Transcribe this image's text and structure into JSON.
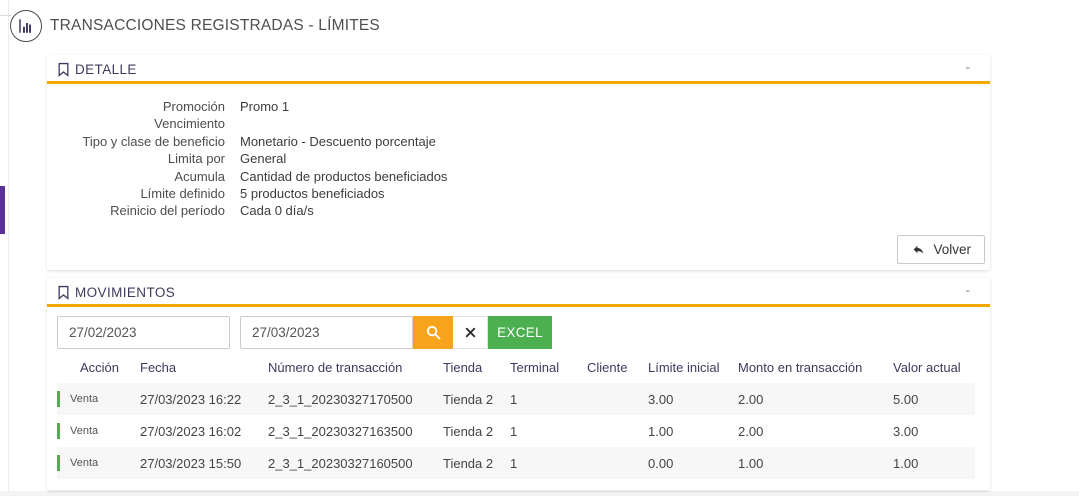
{
  "page": {
    "title": "TRANSACCIONES REGISTRADAS - LÍMITES"
  },
  "detalle": {
    "title": "DETALLE",
    "collapse_label": "-",
    "fields": [
      {
        "label": "Promoción",
        "value": "Promo 1"
      },
      {
        "label": "Vencimiento",
        "value": ""
      },
      {
        "label": "Tipo y clase de beneficio",
        "value": "Monetario - Descuento porcentaje"
      },
      {
        "label": "Limita por",
        "value": "General"
      },
      {
        "label": "Acumula",
        "value": "Cantidad de productos beneficiados"
      },
      {
        "label": "Límite definido",
        "value": "5 productos beneficiados"
      },
      {
        "label": "Reinicio del período",
        "value": "Cada 0 día/s"
      }
    ],
    "back_button_label": "Volver"
  },
  "movimientos": {
    "title": "MOVIMIENTOS",
    "collapse_label": "-",
    "date_from": "27/02/2023",
    "date_to": "27/03/2023",
    "excel_button_label": "EXCEL",
    "table": {
      "columns": [
        "Acción",
        "Fecha",
        "Número de transacción",
        "Tienda",
        "Terminal",
        "Cliente",
        "Límite inicial",
        "Monto en transacción",
        "Valor actual"
      ],
      "rows": [
        {
          "accion": "Venta",
          "fecha": "27/03/2023 16:22",
          "numero": "2_3_1_20230327170500",
          "tienda": "Tienda 2",
          "terminal": "1",
          "cliente": "",
          "limite_inicial": "3.00",
          "monto": "2.00",
          "valor_actual": "5.00"
        },
        {
          "accion": "Venta",
          "fecha": "27/03/2023 16:02",
          "numero": "2_3_1_20230327163500",
          "tienda": "Tienda 2",
          "terminal": "1",
          "cliente": "",
          "limite_inicial": "1.00",
          "monto": "2.00",
          "valor_actual": "3.00"
        },
        {
          "accion": "Venta",
          "fecha": "27/03/2023 15:50",
          "numero": "2_3_1_20230327160500",
          "tienda": "Tienda 2",
          "terminal": "1",
          "cliente": "",
          "limite_inicial": "0.00",
          "monto": "1.00",
          "valor_actual": "1.00"
        }
      ]
    }
  },
  "colors": {
    "accent_orange": "#f5a800",
    "search_button_orange": "#f6a41c",
    "excel_green": "#4caf50",
    "row_indicator_green": "#4caf50",
    "sidebar_purple": "#5c3196",
    "section_title_navy": "#3e3a5d"
  }
}
